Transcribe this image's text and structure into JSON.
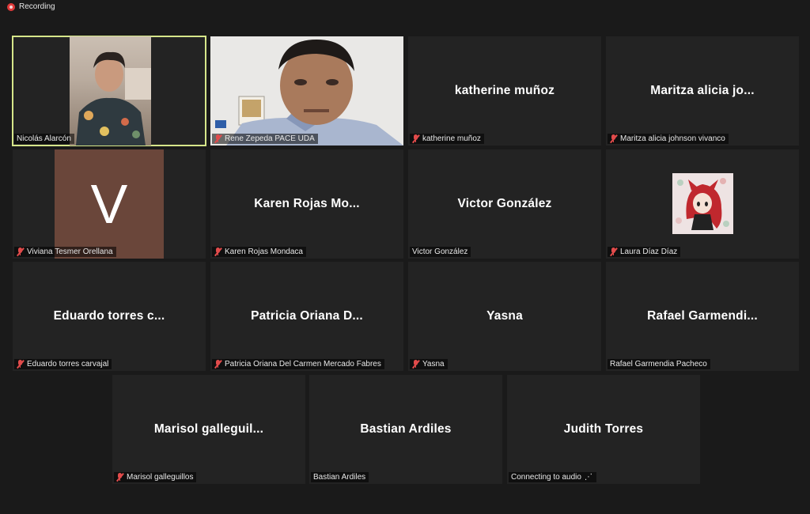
{
  "recording": {
    "label": "Recording"
  },
  "tiles": [
    {
      "name": "",
      "label": "Nicolás Alarcón",
      "muted": false
    },
    {
      "name": "",
      "label": "Rene Zepeda PACE UDA",
      "muted": true
    },
    {
      "name": "katherine muñoz",
      "label": "katherine muñoz",
      "muted": true
    },
    {
      "name": "Maritza alicia jo...",
      "label": "Maritza alicia johnson vivanco",
      "muted": true
    },
    {
      "name": "",
      "avatar_letter": "V",
      "label": "Viviana Tesmer Orellana",
      "muted": true
    },
    {
      "name": "Karen  Rojas  Mo...",
      "label": "Karen Rojas Mondaca",
      "muted": true
    },
    {
      "name": "Victor González",
      "label": "Victor González",
      "muted": false
    },
    {
      "name": "",
      "label": "Laura Díaz Díaz",
      "muted": true
    },
    {
      "name": "Eduardo torres c...",
      "label": "Eduardo torres carvajal",
      "muted": true
    },
    {
      "name": "Patricia Oriana D...",
      "label": "Patricia Oriana Del Carmen Mercado Fabres",
      "muted": true
    },
    {
      "name": "Yasna",
      "label": "Yasna",
      "muted": true
    },
    {
      "name": "Rafael  Garmendi...",
      "label": "Rafael Garmendia Pacheco",
      "muted": false
    },
    {
      "name": "Marisol  galleguil...",
      "label": "Marisol galleguillos",
      "muted": true
    },
    {
      "name": "Bastian Ardiles",
      "label": "Bastian Ardiles",
      "muted": false
    },
    {
      "name": "Judith Torres",
      "label": "Connecting to audio",
      "muted": false
    }
  ],
  "colors": {
    "background": "#1a1a1a",
    "tile": "#232323",
    "active_border": "#d6e68a",
    "mute_red": "#e14b4b",
    "recording_red": "#e03a3a",
    "avatar_v_bg": "#6a463a"
  }
}
